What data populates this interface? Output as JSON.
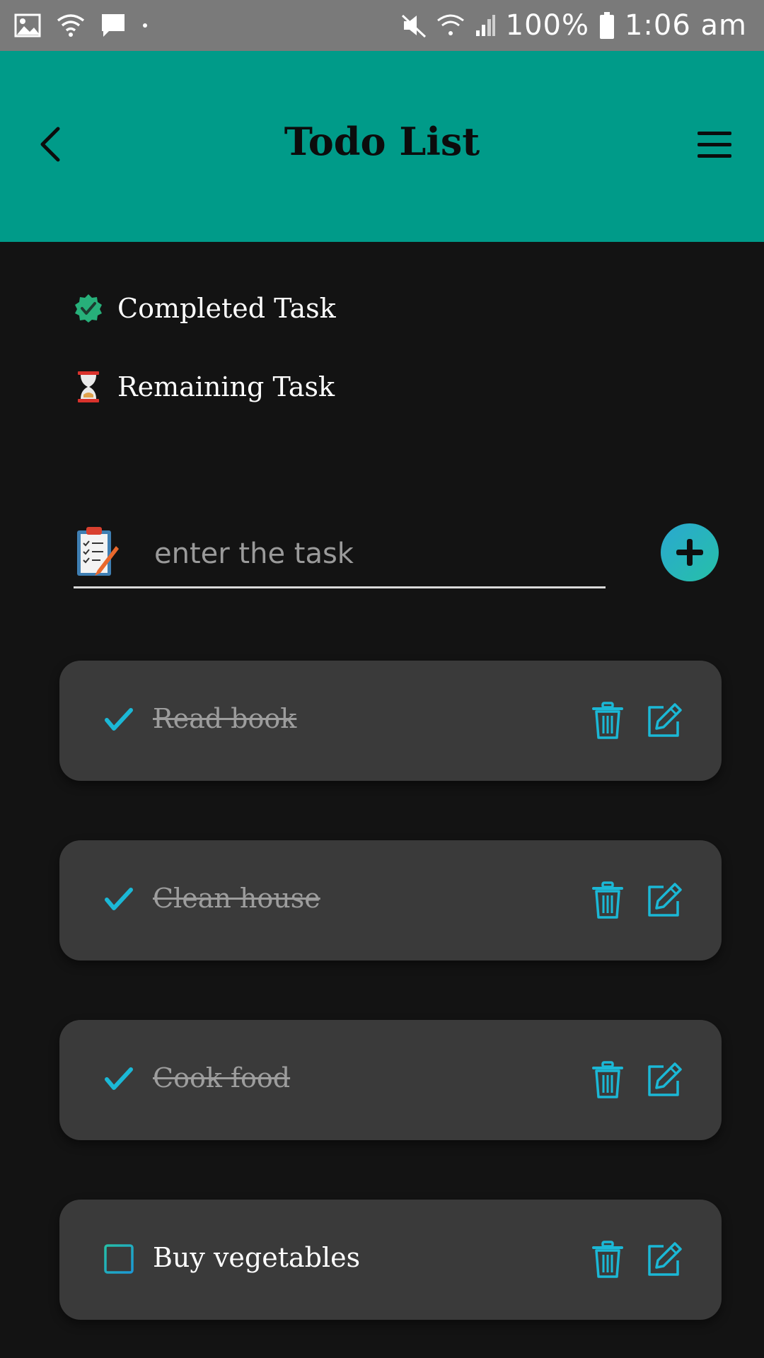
{
  "status_bar": {
    "battery": "100%",
    "time": "1:06 am",
    "icons": [
      "gallery-icon",
      "wifi-icon",
      "chat-icon",
      "dot-icon",
      "mute-icon",
      "wifi-signal-icon",
      "cell-signal-icon",
      "battery-icon"
    ]
  },
  "header": {
    "title": "Todo List",
    "back_icon": "chevron-left-icon",
    "menu_icon": "hamburger-menu-icon",
    "background": "#009b89"
  },
  "legend": {
    "completed": {
      "label": "Completed Task",
      "icon": "verified-badge-icon"
    },
    "remaining": {
      "label": "Remaining Task",
      "icon": "hourglass-icon"
    }
  },
  "input": {
    "placeholder": "enter the task",
    "value": "",
    "icon": "clipboard-icon",
    "add_icon": "plus-icon"
  },
  "tasks": [
    {
      "text": "Read book",
      "completed": true
    },
    {
      "text": "Clean house ",
      "completed": true
    },
    {
      "text": "Cook food",
      "completed": true
    },
    {
      "text": "Buy vegetables",
      "completed": false
    }
  ],
  "colors": {
    "accent": "#1bb8d6",
    "accent_green": "#26c0a8",
    "card": "#3a3a3a",
    "background": "#131313"
  }
}
